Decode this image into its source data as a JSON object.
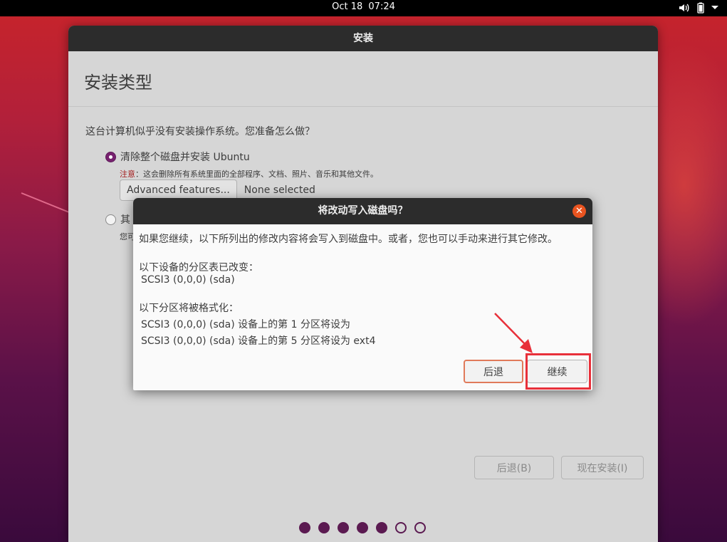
{
  "topbar": {
    "date": "Oct 18",
    "time": "07:24",
    "icons": [
      "volume-icon",
      "battery-icon",
      "menu-arrow-icon"
    ]
  },
  "window": {
    "title": "安装",
    "page_title": "安装类型",
    "question": "这台计算机似乎没有安装操作系统。您准备怎么做？",
    "option1_label": "清除整个磁盘并安装 Ubuntu",
    "option1_checked": true,
    "warning_prefix": "注意",
    "warning_text": "：这会删除所有系统里面的全部程序、文档、照片、音乐和其他文件。",
    "advanced_button": "Advanced features...",
    "advanced_value": "None selected",
    "option2_label_partial": "其",
    "option2_sub_partial": "您可",
    "back_button": "后退(B)",
    "install_button": "现在安装(I)",
    "progress_dots": {
      "total": 7,
      "completed": 5
    }
  },
  "dialog": {
    "title": "将改动写入磁盘吗？",
    "intro": "如果您继续，以下所列出的修改内容将会写入到磁盘中。或者，您也可以手动来进行其它修改。",
    "partition_table_heading": "以下设备的分区表已改变：",
    "device": "SCSI3 (0,0,0) (sda)",
    "format_heading": "以下分区将被格式化：",
    "partition_1": "SCSI3 (0,0,0) (sda) 设备上的第 1 分区将设为",
    "partition_5": "SCSI3 (0,0,0) (sda) 设备上的第 5 分区将设为 ext4",
    "back_label": "后退",
    "continue_label": "继续",
    "close_glyph": "✕"
  },
  "colors": {
    "accent": "#e95420",
    "ubuntu_purple": "#77216f",
    "annotation_red": "#e8303a"
  }
}
